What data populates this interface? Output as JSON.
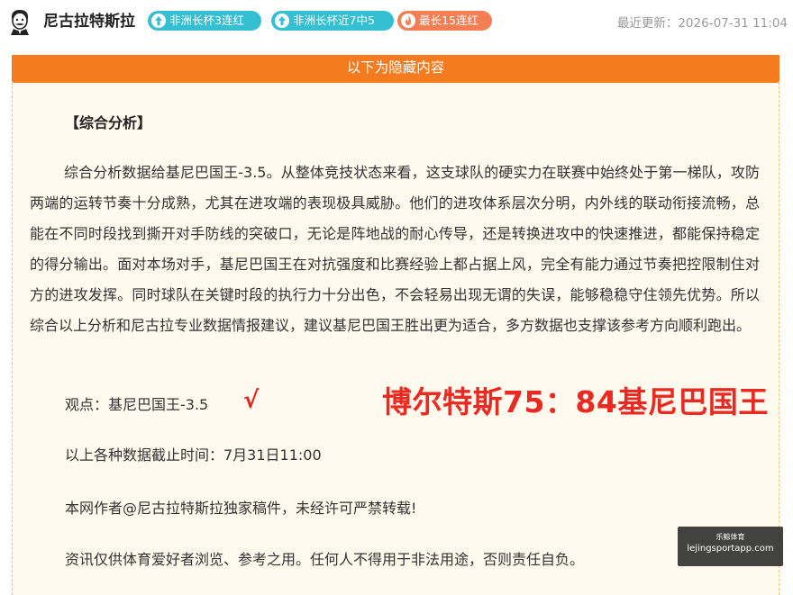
{
  "header": {
    "author": "尼古拉特斯拉",
    "badges": [
      {
        "label": "非洲长杯3连红",
        "icon": "arrow-up-icon",
        "color": "#35bfd3"
      },
      {
        "label": "非洲长杯近7中5",
        "icon": "arrow-up-icon",
        "color": "#35bfd3"
      },
      {
        "label": "最长15连红",
        "icon": "flame-icon",
        "color": "#f47f55"
      }
    ],
    "update_time": "最近更新：2026-07-31 11:04"
  },
  "content": {
    "hidden_bar": "以下为隐藏内容",
    "section_title": "【综合分析】",
    "analysis": "综合分析数据给基尼巴国王-3.5。从整体竞技状态来看，这支球队的硬实力在联赛中始终处于第一梯队，攻防两端的运转节奏十分成熟，尤其在进攻端的表现极具威胁。他们的进攻体系层次分明，内外线的联动衔接流畅，总能在不同时段找到撕开对手防线的突破口，无论是阵地战的耐心传导，还是转换进攻中的快速推进，都能保持稳定的得分输出。面对本场对手，基尼巴国王在对抗强度和比赛经验上都占据上风，完全有能力通过节奏把控限制住对方的进攻发挥。同时球队在关键时段的执行力十分出色，不会轻易出现无谓的失误，能够稳稳守住领先优势。所以综合以上分析和尼古拉专业数据情报建议，建议基尼巴国王胜出更为适合，多方数据也支撑该参考方向顺利跑出。",
    "viewpoint": "观点：基尼巴国王-3.5",
    "check_mark": "√",
    "result": "博尔特斯75：84基尼巴国王",
    "cutoff": "以上各种数据截止时间：7月31日11:00",
    "copyright": "本网作者@尼古拉特斯拉独家稿件，未经许可严禁转载!",
    "disclaimer": "资讯仅供体育爱好者浏览、参考之用。任何人不得用于非法用途，否则责任自负。"
  },
  "watermark": {
    "top": "乐鲸体育",
    "url": "lejingsportapp.com"
  },
  "colors": {
    "accent_orange": "#f47b20",
    "badge_blue": "#35bfd3",
    "badge_orange": "#f47f55",
    "result_red": "#ea2a22",
    "panel_bg": "#fff9ee"
  }
}
